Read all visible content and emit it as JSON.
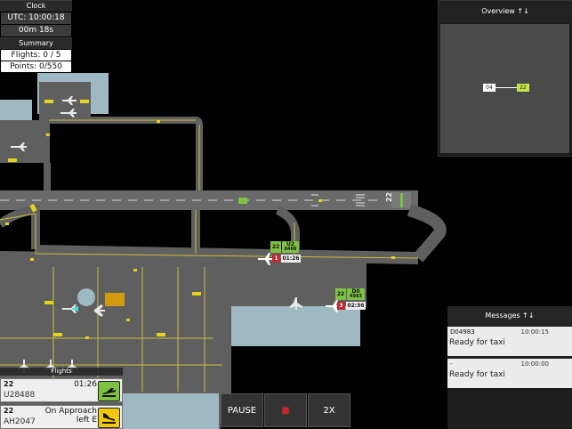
{
  "clock": {
    "title": "Clock",
    "utc": "UTC: 10:00:18",
    "elapsed": "00m 18s",
    "summary_title": "Summary",
    "flights": "Flights: 0 / 5",
    "points": "Points: 0/550"
  },
  "overview": {
    "title": "Overview ↑↓",
    "left_label": "04",
    "right_label": "22"
  },
  "messages": {
    "title": "Messages ↑↓",
    "items": [
      {
        "id": "D04983",
        "time": "10:00:15",
        "text": "Ready for taxi"
      },
      {
        "id": "-",
        "time": "10:00:00",
        "text": "Ready for taxi"
      }
    ]
  },
  "flights": {
    "title": "Flights",
    "items": [
      {
        "runway": "22",
        "callsign": "U28488",
        "status": "01:26",
        "status2": "",
        "button_color": "#7ec243",
        "button_icon": "takeoff-icon"
      },
      {
        "runway": "22",
        "callsign": "AH2047",
        "status": "On Approach",
        "status2": "left E",
        "button_color": "#f2c80f",
        "button_icon": "landing-icon"
      }
    ]
  },
  "controls": {
    "pause": "PAUSE",
    "stop": "■",
    "speed": "2X"
  },
  "aircraft_tags": [
    {
      "runway": "22",
      "callsign": "U2",
      "sub": "8488",
      "rank": "1",
      "timer": "01:26"
    },
    {
      "runway": "22",
      "callsign": "D0",
      "sub": "4983",
      "rank": "3",
      "timer": "02:36"
    }
  ],
  "runway_label": "22",
  "colors": {
    "tarmac": "#5f5f5f",
    "grass": "#000000",
    "water": "#9fb9c3",
    "taxi_line": "#c8bf3a",
    "tag_green": "#7ec243",
    "rank_red": "#c0282d"
  }
}
